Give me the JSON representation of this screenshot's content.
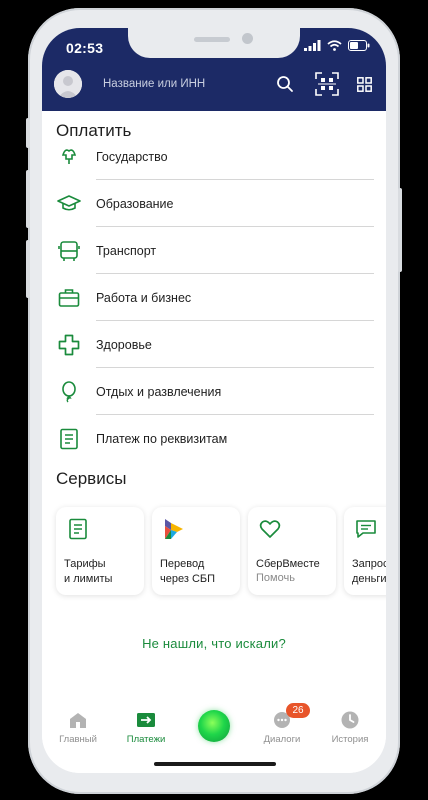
{
  "status": {
    "time": "02:53"
  },
  "search": {
    "placeholder": "Название или ИНН"
  },
  "pay": {
    "title": "Оплатить",
    "items": [
      {
        "label": "Государство",
        "icon": "government-icon"
      },
      {
        "label": "Образование",
        "icon": "graduation-cap-icon"
      },
      {
        "label": "Транспорт",
        "icon": "bus-icon"
      },
      {
        "label": "Работа и бизнес",
        "icon": "briefcase-icon"
      },
      {
        "label": "Здоровье",
        "icon": "medical-cross-icon"
      },
      {
        "label": "Отдых и развлечения",
        "icon": "balloon-icon"
      },
      {
        "label": "Платеж по реквизитам",
        "icon": "document-icon"
      }
    ]
  },
  "services": {
    "title": "Сервисы",
    "cards": [
      {
        "title": "Тарифы\nи лимиты",
        "subtitle": "",
        "icon": "document-icon"
      },
      {
        "title": "Перевод\nчерез СБП",
        "subtitle": "",
        "icon": "sbp-logo-icon"
      },
      {
        "title": "СберВместе",
        "subtitle": "Помочь",
        "icon": "heart-icon"
      },
      {
        "title": "Запрос\nденьги",
        "subtitle": "",
        "icon": "chat-icon"
      }
    ]
  },
  "not_found": "Не нашли, что искали?",
  "tabs": [
    {
      "label": "Главный",
      "icon": "home-icon",
      "active": false
    },
    {
      "label": "Платежи",
      "icon": "payments-icon",
      "active": true
    },
    {
      "label": "",
      "icon": "assistant-icon",
      "active": false
    },
    {
      "label": "Диалоги",
      "icon": "dialogs-icon",
      "active": false,
      "badge": "26"
    },
    {
      "label": "История",
      "icon": "clock-icon",
      "active": false
    }
  ],
  "colors": {
    "header": "#1c2a66",
    "accent": "#1a8b3c",
    "badge": "#e8552a"
  }
}
